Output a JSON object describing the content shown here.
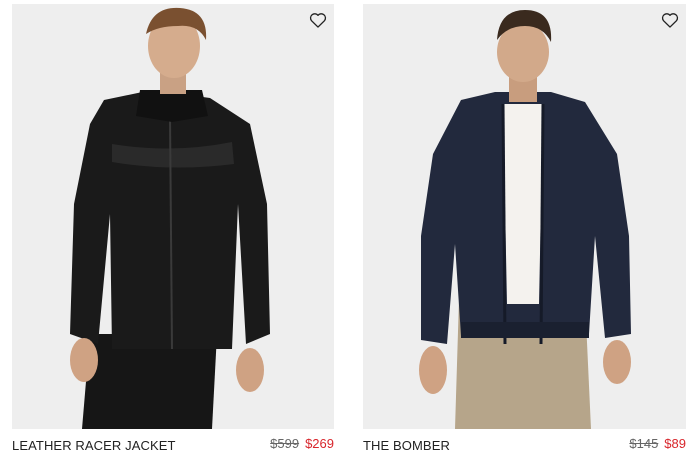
{
  "products": [
    {
      "name": "LEATHER RACER JACKET",
      "original_price": "$599",
      "sale_price": "$269",
      "wishlist_icon": "heart-outline-icon",
      "image": "model wearing black leather racer jacket"
    },
    {
      "name": "THE BOMBER",
      "original_price": "$145",
      "sale_price": "$89",
      "wishlist_icon": "heart-outline-icon",
      "image": "model wearing navy bomber jacket and khaki pants"
    }
  ],
  "colors": {
    "sale": "#d8262c",
    "original": "#666666",
    "name": "#222222",
    "image_bg": "#eeeeee"
  }
}
